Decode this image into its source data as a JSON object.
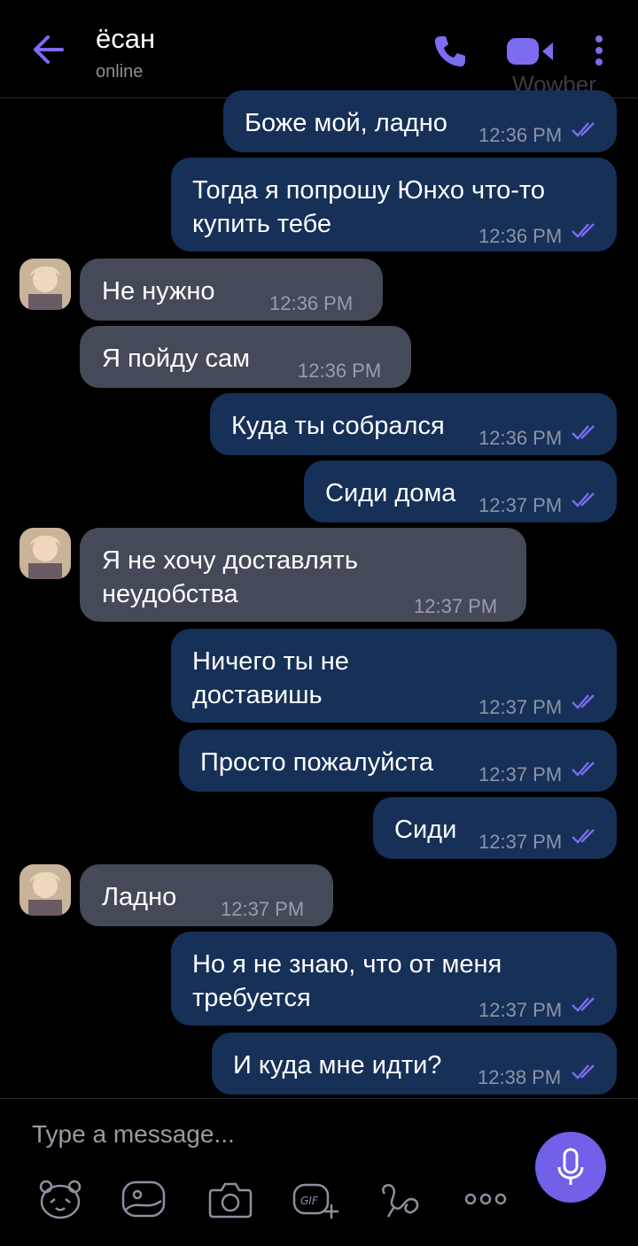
{
  "header": {
    "contact_name": "ёсан",
    "status": "online",
    "watermark": "Wowber",
    "icons": [
      "back-arrow-icon",
      "phone-icon",
      "video-icon",
      "more-vertical-icon"
    ],
    "accent_color": "#7160e8"
  },
  "messages": [
    {
      "direction": "out",
      "text": "Боже мой, ладно",
      "time": "12:36 PM",
      "read": true
    },
    {
      "direction": "out",
      "text": "Тогда я попрошу Юнхо что-то\nкупить тебе",
      "time": "12:36 PM",
      "read": true
    },
    {
      "direction": "in",
      "text": "Не нужно",
      "time": "12:36 PM",
      "avatar": true
    },
    {
      "direction": "in",
      "text": "Я пойду сам",
      "time": "12:36 PM",
      "avatar": false
    },
    {
      "direction": "out",
      "text": "Куда ты собрался",
      "time": "12:36 PM",
      "read": true
    },
    {
      "direction": "out",
      "text": "Сиди дома",
      "time": "12:37 PM",
      "read": true
    },
    {
      "direction": "in",
      "text": "Я не хочу доставлять\nнеудобства",
      "time": "12:37 PM",
      "avatar": true
    },
    {
      "direction": "out",
      "text": "Ничего ты не\nдоставишь",
      "time": "12:37 PM",
      "read": true
    },
    {
      "direction": "out",
      "text": "Просто пожалуйста",
      "time": "12:37 PM",
      "read": true
    },
    {
      "direction": "out",
      "text": "Сиди",
      "time": "12:37 PM",
      "read": true
    },
    {
      "direction": "in",
      "text": "Ладно",
      "time": "12:37 PM",
      "avatar": true
    },
    {
      "direction": "out",
      "text": "Но я не знаю, что от меня\nтребуется",
      "time": "12:37 PM",
      "read": true
    },
    {
      "direction": "out",
      "text": "И куда мне идти?",
      "time": "12:38 PM",
      "read": true
    }
  ],
  "composer": {
    "placeholder": "Type a message...",
    "toolbar_icons": [
      "sticker-bear-icon",
      "gallery-icon",
      "camera-icon",
      "gif-icon",
      "doodle-icon",
      "more-horizontal-icon"
    ],
    "mic_icon": "microphone-icon"
  }
}
